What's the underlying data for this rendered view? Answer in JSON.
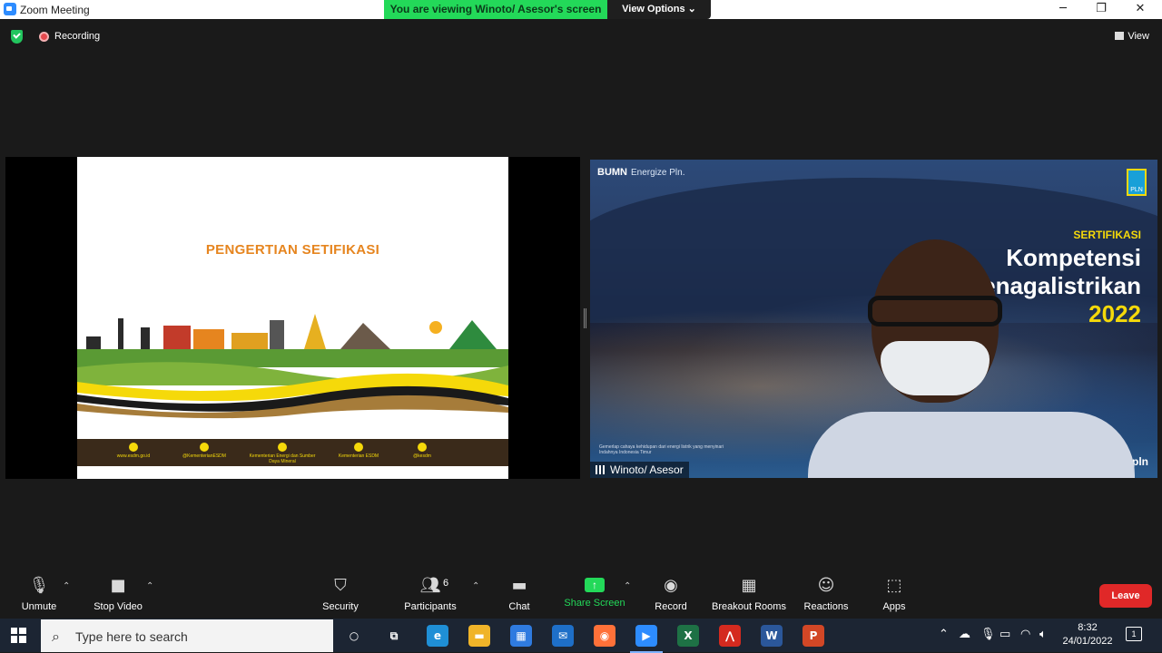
{
  "window": {
    "title": "Zoom Meeting",
    "minimize": "─",
    "restore": "❐",
    "close": "✕"
  },
  "banner": {
    "text": "You are viewing Winoto/ Asesor's screen",
    "view_options": "View Options ⌄"
  },
  "status": {
    "recording_label": "Recording",
    "view_label": "View"
  },
  "slide": {
    "title": "PENGERTIAN SETIFIKASI",
    "footer": [
      {
        "label": "www.esdm.go.id",
        "icon": "globe-icon"
      },
      {
        "label": "@KementerianESDM",
        "icon": "twitter-icon"
      },
      {
        "label": "Kementerian Energi dan Sumber Daya Mineral",
        "icon": "facebook-icon"
      },
      {
        "label": "Kementerian ESDM",
        "icon": "youtube-icon"
      },
      {
        "label": "@kesdm",
        "icon": "instagram-icon"
      }
    ]
  },
  "video": {
    "logo": "BUMN",
    "logo_sub": "Energize Pln.",
    "pln": "PLN",
    "sertifikasi": "SERTIFIKASI",
    "kompetensi": "Kompetensi",
    "ketenagalistrikan": "etenagalistrikan",
    "year": "2022",
    "hashtag": "#Ispuserpln",
    "tagline": "Gemerlap cahaya kehidupan dari energi listrik yang menyinari Indahnya Indonesia Timur",
    "participant_name": "Winoto/ Asesor"
  },
  "toolbar": {
    "unmute": "Unmute",
    "stop_video": "Stop Video",
    "security": "Security",
    "participants": "Participants",
    "participants_count": "6",
    "chat": "Chat",
    "share_screen": "Share Screen",
    "record": "Record",
    "breakout_rooms": "Breakout Rooms",
    "reactions": "Reactions",
    "apps": "Apps",
    "leave": "Leave"
  },
  "taskbar": {
    "search_placeholder": "Type here to search",
    "time": "8:32",
    "date": "24/01/2022",
    "notifications": "1",
    "apps": [
      {
        "icon": "cortana-icon",
        "glyph": "○",
        "color": "transparent"
      },
      {
        "icon": "task-view-icon",
        "glyph": "⧉",
        "color": "transparent"
      },
      {
        "icon": "edge-icon",
        "glyph": "e",
        "color": "#1f8fd6"
      },
      {
        "icon": "file-explorer-icon",
        "glyph": "▬",
        "color": "#f0b429"
      },
      {
        "icon": "store-icon",
        "glyph": "▦",
        "color": "#2f7be0"
      },
      {
        "icon": "mail-icon",
        "glyph": "✉",
        "color": "#1e6fc8"
      },
      {
        "icon": "firefox-icon",
        "glyph": "◉",
        "color": "#ff7139"
      },
      {
        "icon": "zoom-icon",
        "glyph": "▶",
        "color": "#2d8cff"
      },
      {
        "icon": "excel-icon",
        "glyph": "X",
        "color": "#1e7145"
      },
      {
        "icon": "acrobat-icon",
        "glyph": "⋀",
        "color": "#d42a1f"
      },
      {
        "icon": "word-icon",
        "glyph": "W",
        "color": "#2b579a"
      },
      {
        "icon": "powerpoint-icon",
        "glyph": "P",
        "color": "#d24726"
      }
    ]
  }
}
